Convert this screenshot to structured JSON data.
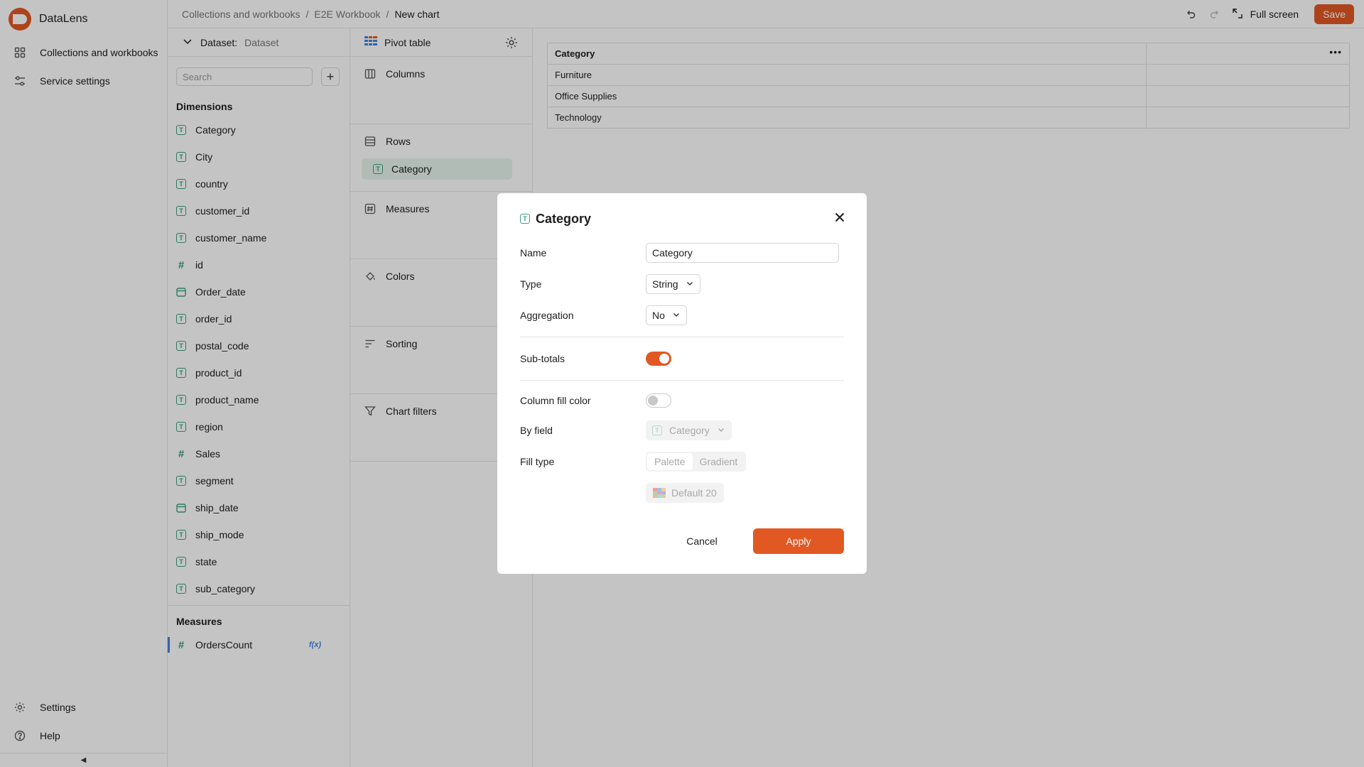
{
  "app": {
    "name": "DataLens"
  },
  "nav": {
    "collections": "Collections and workbooks",
    "service_settings": "Service settings",
    "settings": "Settings",
    "help": "Help"
  },
  "breadcrumbs": [
    "Collections and workbooks",
    "E2E Workbook",
    "New chart"
  ],
  "header": {
    "full_screen": "Full screen",
    "save": "Save"
  },
  "dataset": {
    "label": "Dataset:",
    "value": "Dataset",
    "search_placeholder": "Search",
    "dimensions_title": "Dimensions",
    "dimensions": [
      {
        "name": "Category",
        "type": "text"
      },
      {
        "name": "City",
        "type": "text"
      },
      {
        "name": "country",
        "type": "text"
      },
      {
        "name": "customer_id",
        "type": "text"
      },
      {
        "name": "customer_name",
        "type": "text"
      },
      {
        "name": "id",
        "type": "number"
      },
      {
        "name": "Order_date",
        "type": "date"
      },
      {
        "name": "order_id",
        "type": "text"
      },
      {
        "name": "postal_code",
        "type": "text"
      },
      {
        "name": "product_id",
        "type": "text"
      },
      {
        "name": "product_name",
        "type": "text"
      },
      {
        "name": "region",
        "type": "text"
      },
      {
        "name": "Sales",
        "type": "number"
      },
      {
        "name": "segment",
        "type": "text"
      },
      {
        "name": "ship_date",
        "type": "date"
      },
      {
        "name": "ship_mode",
        "type": "text"
      },
      {
        "name": "state",
        "type": "text"
      },
      {
        "name": "sub_category",
        "type": "text"
      }
    ],
    "measures_title": "Measures",
    "measures": [
      {
        "name": "OrdersCount",
        "type": "number",
        "badge": "f(x)"
      }
    ]
  },
  "visualization": {
    "type": "Pivot table",
    "sections": {
      "columns": "Columns",
      "rows": "Rows",
      "rows_item": "Category",
      "measures": "Measures",
      "colors": "Colors",
      "sorting": "Sorting",
      "filters": "Chart filters"
    }
  },
  "table": {
    "header": "Category",
    "rows": [
      "Furniture",
      "Office Supplies",
      "Technology"
    ]
  },
  "modal": {
    "title": "Category",
    "name_label": "Name",
    "name_value": "Category",
    "type_label": "Type",
    "type_value": "String",
    "aggregation_label": "Aggregation",
    "aggregation_value": "No",
    "subtotals_label": "Sub-totals",
    "subtotals_on": true,
    "fill_label": "Column fill color",
    "fill_on": false,
    "by_field_label": "By field",
    "by_field_value": "Category",
    "fill_type_label": "Fill type",
    "fill_type_options": [
      "Palette",
      "Gradient"
    ],
    "fill_type_selected": "Palette",
    "palette_value": "Default 20",
    "cancel": "Cancel",
    "apply": "Apply"
  },
  "colors": {
    "accent": "#e25822",
    "field_icon": "#3aa17e",
    "measure_marker": "#3f82e0"
  }
}
